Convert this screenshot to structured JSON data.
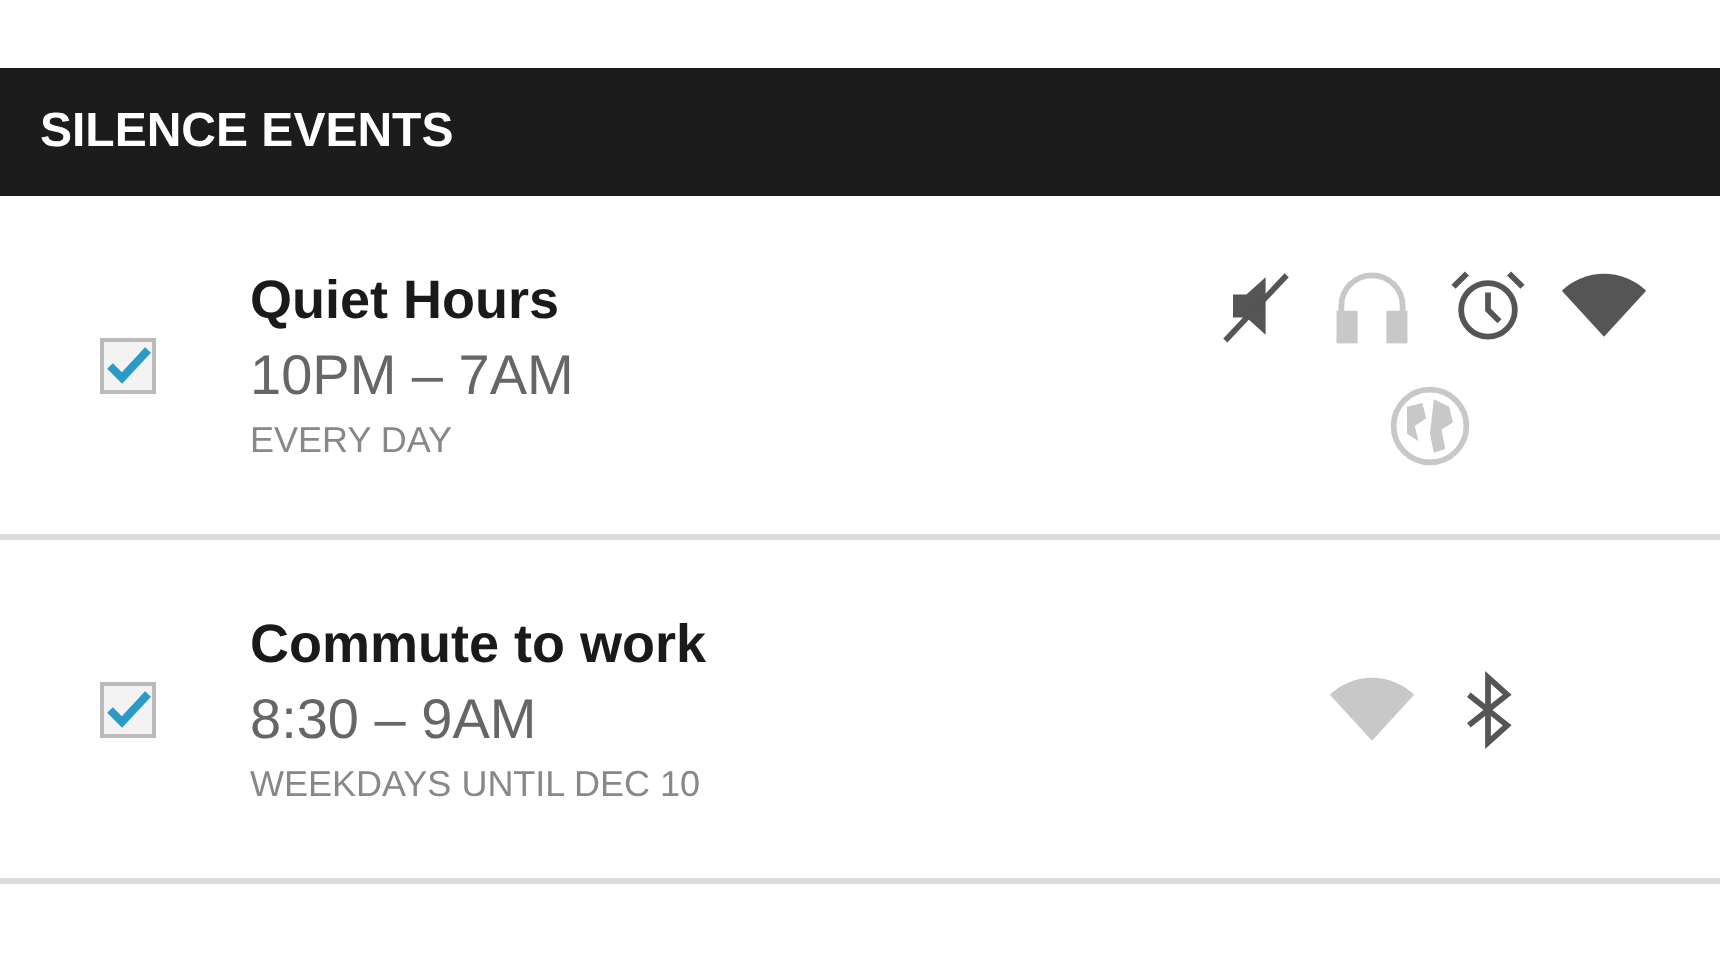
{
  "header": {
    "title": "SILENCE EVENTS"
  },
  "events": [
    {
      "title": "Quiet Hours",
      "time": "10PM – 7AM",
      "repeat": "EVERY DAY",
      "checked": true,
      "icons": [
        {
          "kind": "mute",
          "enabled": true
        },
        {
          "kind": "headphones",
          "enabled": false
        },
        {
          "kind": "alarm",
          "enabled": true
        },
        {
          "kind": "wifi",
          "enabled": true
        },
        {
          "kind": "globe",
          "enabled": false
        }
      ]
    },
    {
      "title": "Commute to work",
      "time": "8:30 – 9AM",
      "repeat": "WEEKDAYS UNTIL DEC 10",
      "checked": true,
      "icons": [
        {
          "kind": "wifi",
          "enabled": false
        },
        {
          "kind": "bluetooth",
          "enabled": true
        }
      ]
    }
  ]
}
